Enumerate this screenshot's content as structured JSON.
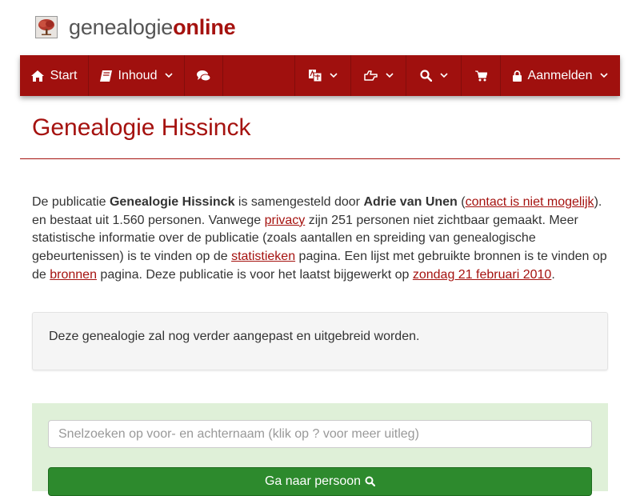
{
  "brand": {
    "name_part1": "genealogie",
    "name_part2": "online"
  },
  "nav": {
    "start_label": "Start",
    "inhoud_label": "Inhoud",
    "login_label": "Aanmelden",
    "items": [
      {
        "icon": "home-icon"
      },
      {
        "icon": "book-icon"
      },
      {
        "icon": "comments-icon"
      },
      {
        "icon": "translate-icon"
      },
      {
        "icon": "hand-point-icon"
      },
      {
        "icon": "search-icon"
      },
      {
        "icon": "shopping-cart-icon"
      },
      {
        "icon": "lock-icon"
      }
    ]
  },
  "page": {
    "title": "Genealogie Hissinck",
    "intro": {
      "t1": "De publicatie ",
      "pub_name": "Genealogie Hissinck",
      "t2": " is samengesteld door ",
      "author": "Adrie van Unen",
      "t3": " (",
      "contact_link": "contact is niet mogelijk",
      "t4": "). en bestaat uit 1.560 personen. Vanwege ",
      "privacy_link": "privacy",
      "t5": " zijn 251 personen niet zichtbaar gemaakt. Meer statistische informatie over de publicatie (zoals aantallen en spreiding van genealogische gebeurtenissen) is te vinden op de ",
      "stats_link": "statistieken",
      "t6": " pagina. Een lijst met gebruikte bronnen is te vinden op de ",
      "sources_link": "bronnen",
      "t7": " pagina. Deze publicatie is voor het laatst bijgewerkt op ",
      "date_link": "zondag 21 februari 2010",
      "t8": "."
    },
    "notice": "Deze genealogie zal nog verder aangepast en uitgebreid worden."
  },
  "search": {
    "placeholder": "Snelzoeken op voor- en achternaam (klik op ? voor meer uitleg)",
    "button_label": "Ga naar persoon"
  },
  "colors": {
    "brand_red": "#a5120f",
    "navbar_bg": "#a0100e",
    "search_panel_bg": "#dff0d8",
    "button_green": "#2d8a2d"
  }
}
